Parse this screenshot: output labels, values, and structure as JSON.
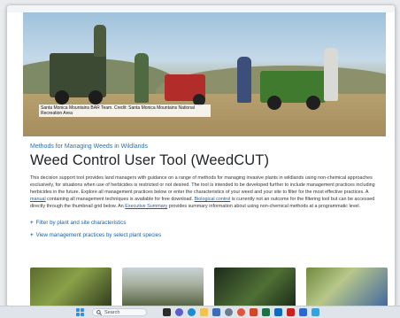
{
  "hero": {
    "caption": "Santa Monica Mountains BAR Team. Credit: Santa Monica Mountains National Recreation Area"
  },
  "article": {
    "eyebrow": "Methods for Managing Weeds in Wildlands",
    "title": "Weed Control User Tool (WeedCUT)",
    "para_1": "This decision support tool provides land managers with guidance on a range of methods for managing invasive plants in wildlands using non-chemical approaches exclusively, for situations when use of herbicides is restricted or not desired. The tool is intended to be developed further to include management practices including herbicides in the future. Explore all management practices below or enter the characteristics of your weed and your site to filter for the most effective practices. A ",
    "link_manual": "manual",
    "para_2": " containing all management techniques is available for free download. ",
    "link_biocontrol": "Biological control",
    "para_3": " is currently not an outcome for the filtering tool but can be accessed directly through the thumbnail grid below. An ",
    "link_exec": "Executive Summary",
    "para_4": " provides summary information about using non-chemical methods at a programmatic level."
  },
  "accordions": [
    {
      "label": "Filter by plant and site characteristics"
    },
    {
      "label": "View management practices by select plant species"
    }
  ],
  "taskbar": {
    "search_placeholder": "Search",
    "start_icon": "windows-start-icon",
    "apps": [
      "task-view-icon",
      "chat-icon",
      "edge-icon",
      "file-explorer-icon",
      "store-icon",
      "settings-icon",
      "chrome-icon",
      "office-icon",
      "excel-icon",
      "outlook-icon",
      "acrobat-icon",
      "word-icon",
      "photos-icon"
    ]
  },
  "colors": {
    "link": "#1a5fa5",
    "eyebrow": "#2f6fa8",
    "title": "#1f2327"
  }
}
